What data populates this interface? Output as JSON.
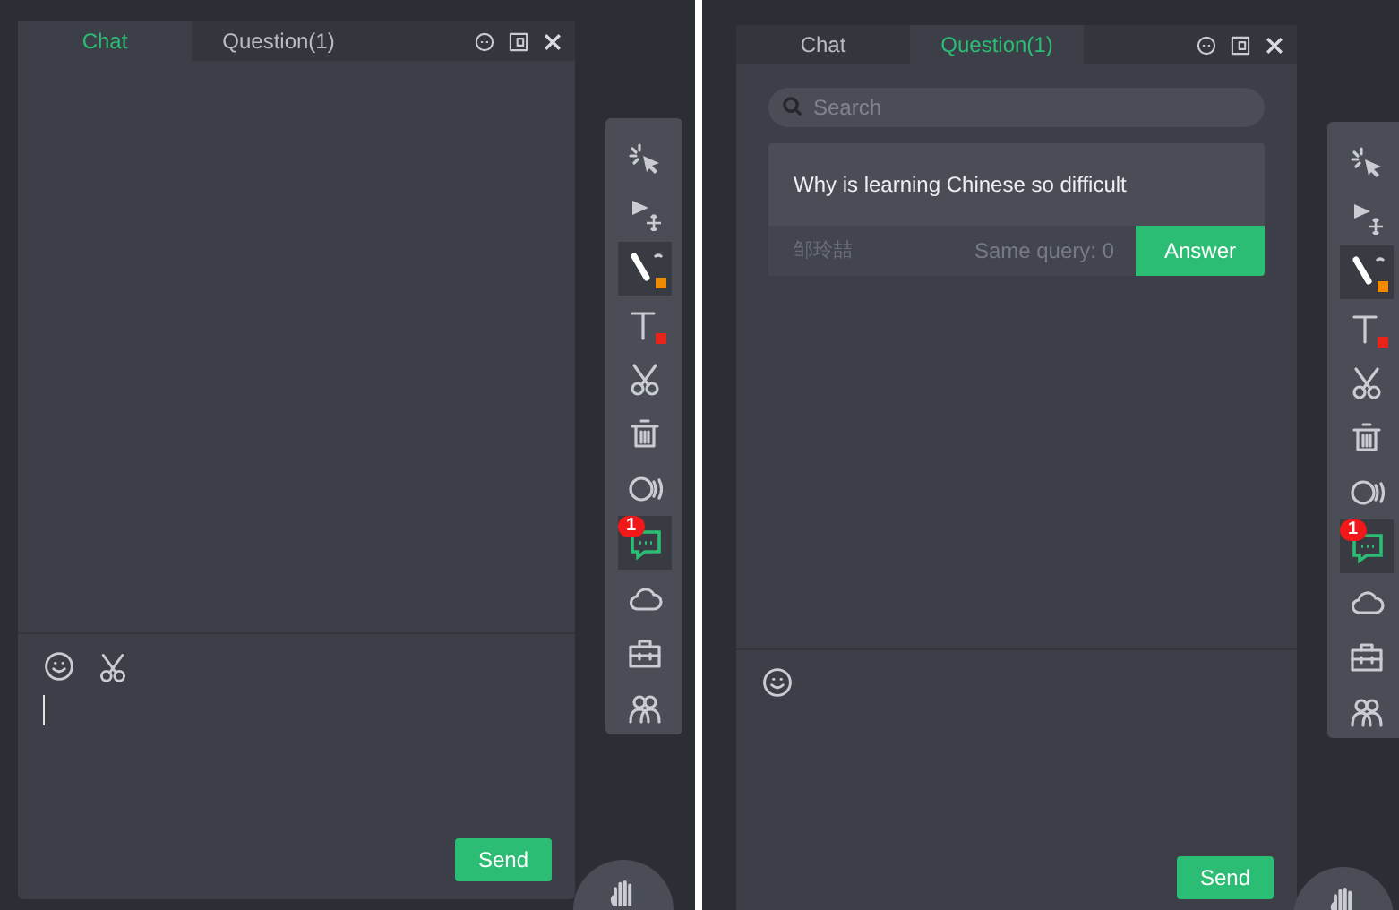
{
  "panels": [
    {
      "tabs": [
        {
          "label": "Chat",
          "selected": true
        },
        {
          "label": "Question(1)",
          "selected": false
        }
      ],
      "composer": {
        "tools": [
          {
            "kind": "emoji"
          },
          {
            "kind": "scissors"
          }
        ],
        "focused": true,
        "send": "Send"
      },
      "toolbar": [
        {
          "kind": "laser",
          "selected": false
        },
        {
          "kind": "move",
          "selected": false
        },
        {
          "kind": "pen",
          "selected": true,
          "color": "#f08a00"
        },
        {
          "kind": "text",
          "selected": false,
          "color": "#e8231a"
        },
        {
          "kind": "scissors",
          "selected": false
        },
        {
          "kind": "trash",
          "selected": false
        },
        {
          "kind": "audio",
          "selected": false
        },
        {
          "kind": "chat",
          "selected": true,
          "badge": "1"
        },
        {
          "kind": "cloud",
          "selected": false
        },
        {
          "kind": "toolbox",
          "selected": false
        },
        {
          "kind": "people",
          "selected": false
        }
      ]
    },
    {
      "tabs": [
        {
          "label": "Chat",
          "selected": false
        },
        {
          "label": "Question(1)",
          "selected": true
        }
      ],
      "search": {
        "placeholder": "Search"
      },
      "questions": [
        {
          "text": "Why is learning Chinese so difficult",
          "author": "邹玲喆",
          "same_query": "Same query: 0",
          "action": "Answer"
        }
      ],
      "composer": {
        "tools": [
          {
            "kind": "emoji"
          }
        ],
        "send": "Send"
      },
      "toolbar": [
        {
          "kind": "laser",
          "selected": false
        },
        {
          "kind": "move",
          "selected": false
        },
        {
          "kind": "pen",
          "selected": true,
          "color": "#f08a00"
        },
        {
          "kind": "text",
          "selected": false,
          "color": "#e8231a"
        },
        {
          "kind": "scissors",
          "selected": false
        },
        {
          "kind": "trash",
          "selected": false
        },
        {
          "kind": "audio",
          "selected": false
        },
        {
          "kind": "chat",
          "selected": true,
          "badge": "1"
        },
        {
          "kind": "cloud",
          "selected": false
        },
        {
          "kind": "toolbox",
          "selected": false
        },
        {
          "kind": "people",
          "selected": false
        }
      ]
    }
  ]
}
